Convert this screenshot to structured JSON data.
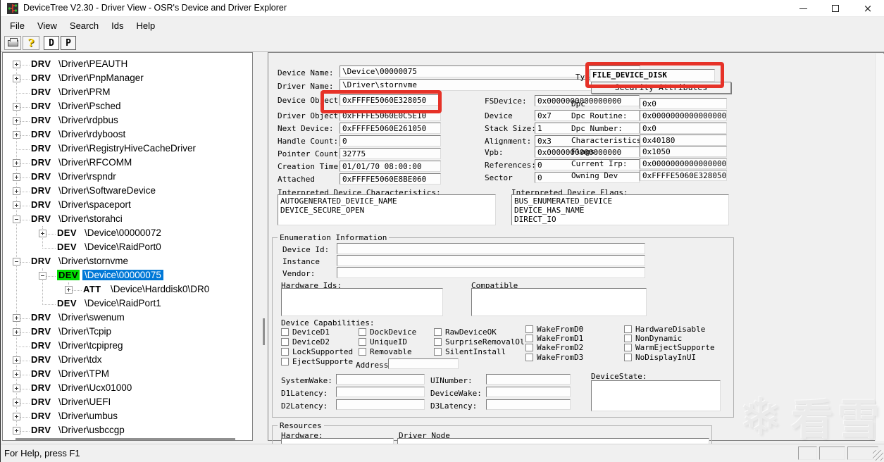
{
  "window": {
    "title": "DeviceTree V2.30 - Driver View - OSR's Device and Driver Explorer"
  },
  "menu": {
    "items": [
      "File",
      "View",
      "Search",
      "Ids",
      "Help"
    ]
  },
  "toolbar": {
    "d_label": "D",
    "p_label": "P"
  },
  "tree": {
    "items": [
      {
        "expand": "+",
        "tag": "DRV",
        "label": "\\Driver\\PEAUTH",
        "level": 1
      },
      {
        "expand": "+",
        "tag": "DRV",
        "label": "\\Driver\\PnpManager",
        "level": 1
      },
      {
        "expand": "",
        "tag": "DRV",
        "label": "\\Driver\\PRM",
        "level": 1
      },
      {
        "expand": "+",
        "tag": "DRV",
        "label": "\\Driver\\Psched",
        "level": 1
      },
      {
        "expand": "+",
        "tag": "DRV",
        "label": "\\Driver\\rdpbus",
        "level": 1
      },
      {
        "expand": "+",
        "tag": "DRV",
        "label": "\\Driver\\rdyboost",
        "level": 1
      },
      {
        "expand": "",
        "tag": "DRV",
        "label": "\\Driver\\RegistryHiveCacheDriver",
        "level": 1
      },
      {
        "expand": "+",
        "tag": "DRV",
        "label": "\\Driver\\RFCOMM",
        "level": 1
      },
      {
        "expand": "+",
        "tag": "DRV",
        "label": "\\Driver\\rspndr",
        "level": 1
      },
      {
        "expand": "+",
        "tag": "DRV",
        "label": "\\Driver\\SoftwareDevice",
        "level": 1
      },
      {
        "expand": "+",
        "tag": "DRV",
        "label": "\\Driver\\spaceport",
        "level": 1
      },
      {
        "expand": "-",
        "tag": "DRV",
        "label": "\\Driver\\storahci",
        "level": 1
      },
      {
        "expand": "+",
        "tag": "DEV",
        "label": "\\Device\\00000072",
        "level": 2
      },
      {
        "expand": "",
        "tag": "DEV",
        "label": "\\Device\\RaidPort0",
        "level": 2
      },
      {
        "expand": "-",
        "tag": "DRV",
        "label": "\\Driver\\stornvme",
        "level": 1
      },
      {
        "expand": "-",
        "tag": "DEV",
        "label": "\\Device\\00000075",
        "level": 2,
        "tag_highlight": true,
        "selected": true
      },
      {
        "expand": "+",
        "tag": "ATT",
        "label": "\\Device\\Harddisk0\\DR0",
        "level": 3
      },
      {
        "expand": "",
        "tag": "DEV",
        "label": "\\Device\\RaidPort1",
        "level": 2
      },
      {
        "expand": "+",
        "tag": "DRV",
        "label": "\\Driver\\swenum",
        "level": 1
      },
      {
        "expand": "+",
        "tag": "DRV",
        "label": "\\Driver\\Tcpip",
        "level": 1
      },
      {
        "expand": "",
        "tag": "DRV",
        "label": "\\Driver\\tcpipreg",
        "level": 1
      },
      {
        "expand": "+",
        "tag": "DRV",
        "label": "\\Driver\\tdx",
        "level": 1
      },
      {
        "expand": "+",
        "tag": "DRV",
        "label": "\\Driver\\TPM",
        "level": 1
      },
      {
        "expand": "+",
        "tag": "DRV",
        "label": "\\Driver\\Ucx01000",
        "level": 1
      },
      {
        "expand": "+",
        "tag": "DRV",
        "label": "\\Driver\\UEFI",
        "level": 1
      },
      {
        "expand": "+",
        "tag": "DRV",
        "label": "\\Driver\\umbus",
        "level": 1
      },
      {
        "expand": "+",
        "tag": "DRV",
        "label": "\\Driver\\usbccgp",
        "level": 1
      }
    ]
  },
  "panel": {
    "device_name": {
      "label": "Device Name:",
      "value": "\\Device\\00000075"
    },
    "driver_name": {
      "label": "Driver Name:",
      "value": "\\Driver\\stornvme"
    },
    "type": {
      "label": "Type",
      "value": "FILE_DEVICE_DISK"
    },
    "security_button": "Security Attributes",
    "col1": [
      {
        "label": "Device Object",
        "value": "0xFFFFE5060E328050"
      },
      {
        "label": "Driver Object:",
        "value": "0xFFFFE5060E0C5E10"
      },
      {
        "label": "Next Device:",
        "value": "0xFFFFE5060E261050"
      },
      {
        "label": "Handle Count:",
        "value": "0"
      },
      {
        "label": "Pointer Count:",
        "value": "32775"
      },
      {
        "label": "Creation Time:",
        "value": "01/01/70 08:00:00"
      },
      {
        "label": "Attached",
        "value": "0xFFFFE5060E8BE060"
      }
    ],
    "col2": [
      {
        "label": "FSDevice:",
        "value": "0x0000000000000000"
      },
      {
        "label": "Device",
        "value": "0x7"
      },
      {
        "label": "Stack Size:",
        "value": "1"
      },
      {
        "label": "Alignment:",
        "value": "0x3"
      },
      {
        "label": "Vpb:",
        "value": "0x0000000000000000"
      },
      {
        "label": "References:",
        "value": "0"
      },
      {
        "label": "Sector",
        "value": "0"
      }
    ],
    "col3": [
      {
        "label": "Dpc",
        "value": "0x0"
      },
      {
        "label": "Dpc Routine:",
        "value": "0x0000000000000000"
      },
      {
        "label": "Dpc Number:",
        "value": "0x0"
      },
      {
        "label": "Characteristics",
        "value": "0x40180"
      },
      {
        "label": "Flags:",
        "value": "0x1050"
      },
      {
        "label": "Current Irp:",
        "value": "0x0000000000000000"
      },
      {
        "label": "Owning Dev",
        "value": "0xFFFFE5060E328050"
      }
    ],
    "interpreted_characteristics": {
      "label": "Interpreted Device Characteristics:",
      "lines": [
        "AUTOGENERATED_DEVICE_NAME",
        "DEVICE_SECURE_OPEN"
      ]
    },
    "interpreted_flags": {
      "label": "Interpreted Device Flags:",
      "lines": [
        "BUS_ENUMERATED_DEVICE",
        "DEVICE_HAS_NAME",
        "DIRECT_IO"
      ]
    },
    "enumeration": {
      "title": "Enumeration Information",
      "rows": [
        {
          "label": "Device Id:",
          "value": ""
        },
        {
          "label": "Instance",
          "value": ""
        },
        {
          "label": "Vendor:",
          "value": ""
        }
      ],
      "hardware_ids_label": "Hardware Ids:",
      "compatible_label": "Compatible",
      "capabilities_title": "Device Capabilities:",
      "capability_columns": [
        [
          "DeviceD1",
          "DeviceD2",
          "LockSupported",
          "EjectSupporte"
        ],
        [
          "DockDevice",
          "UniqueID",
          "Removable"
        ],
        [
          "RawDeviceOK",
          "SurpriseRemovalOl",
          "SilentInstall"
        ],
        [
          "WakeFromD0",
          "WakeFromD1",
          "WakeFromD2",
          "WakeFromD3"
        ],
        [
          "HardwareDisable",
          "NonDynamic",
          "WarmEjectSupporte",
          "NoDisplayInUI"
        ]
      ],
      "address_label": "Address",
      "power_left": [
        "SystemWake:",
        "D1Latency:",
        "D2Latency:"
      ],
      "power_mid": [
        "UINumber:",
        "DeviceWake:",
        "D3Latency:"
      ],
      "device_state_label": "DeviceState:"
    },
    "resources": {
      "title": "Resources",
      "hardware_label": "Hardware:",
      "driver_node_label": "Driver Node"
    }
  },
  "statusbar": {
    "text": "For Help, press F1"
  },
  "watermark": {
    "text": "看雪"
  },
  "colors": {
    "selection": "#0078d7",
    "dev_highlight": "#00dc00",
    "annotation": "#e63228"
  }
}
